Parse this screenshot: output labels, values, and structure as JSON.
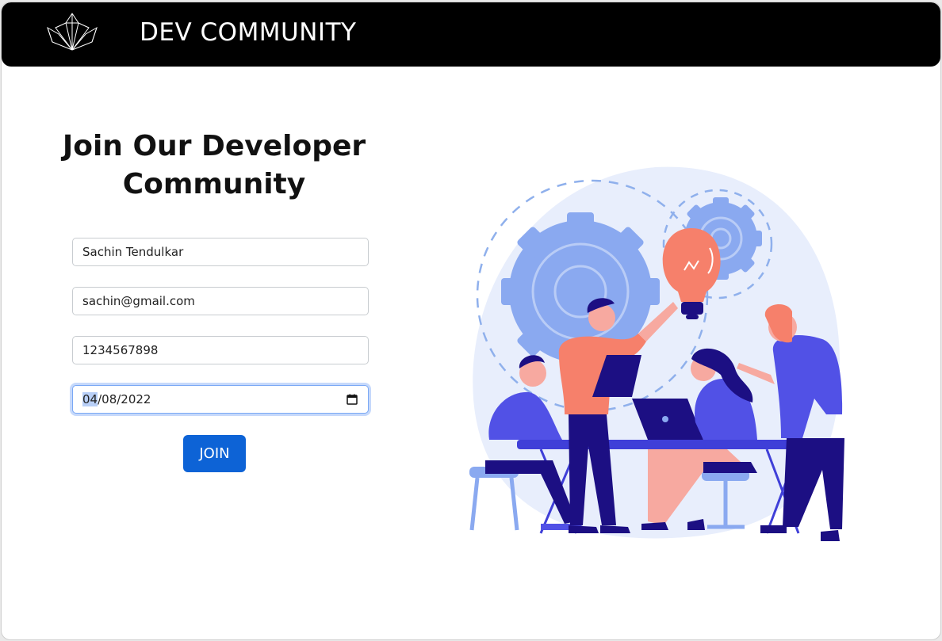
{
  "navbar": {
    "brand": "DEV COMMUNITY"
  },
  "form": {
    "heading": "Join Our Developer Community",
    "name_value": "Sachin Tendulkar",
    "email_value": "sachin@gmail.com",
    "phone_value": "1234567898",
    "date_month": "04",
    "date_rest": "/08/2022",
    "join_label": "JOIN"
  },
  "colors": {
    "navbar_bg": "#000000",
    "button_bg": "#0d63d6",
    "illustration_primary": "#8aa9f0",
    "illustration_accent": "#f6806b",
    "illustration_dark": "#1c0f83"
  },
  "icons": [
    "logo-icon",
    "calendar-icon",
    "team-illustration"
  ]
}
